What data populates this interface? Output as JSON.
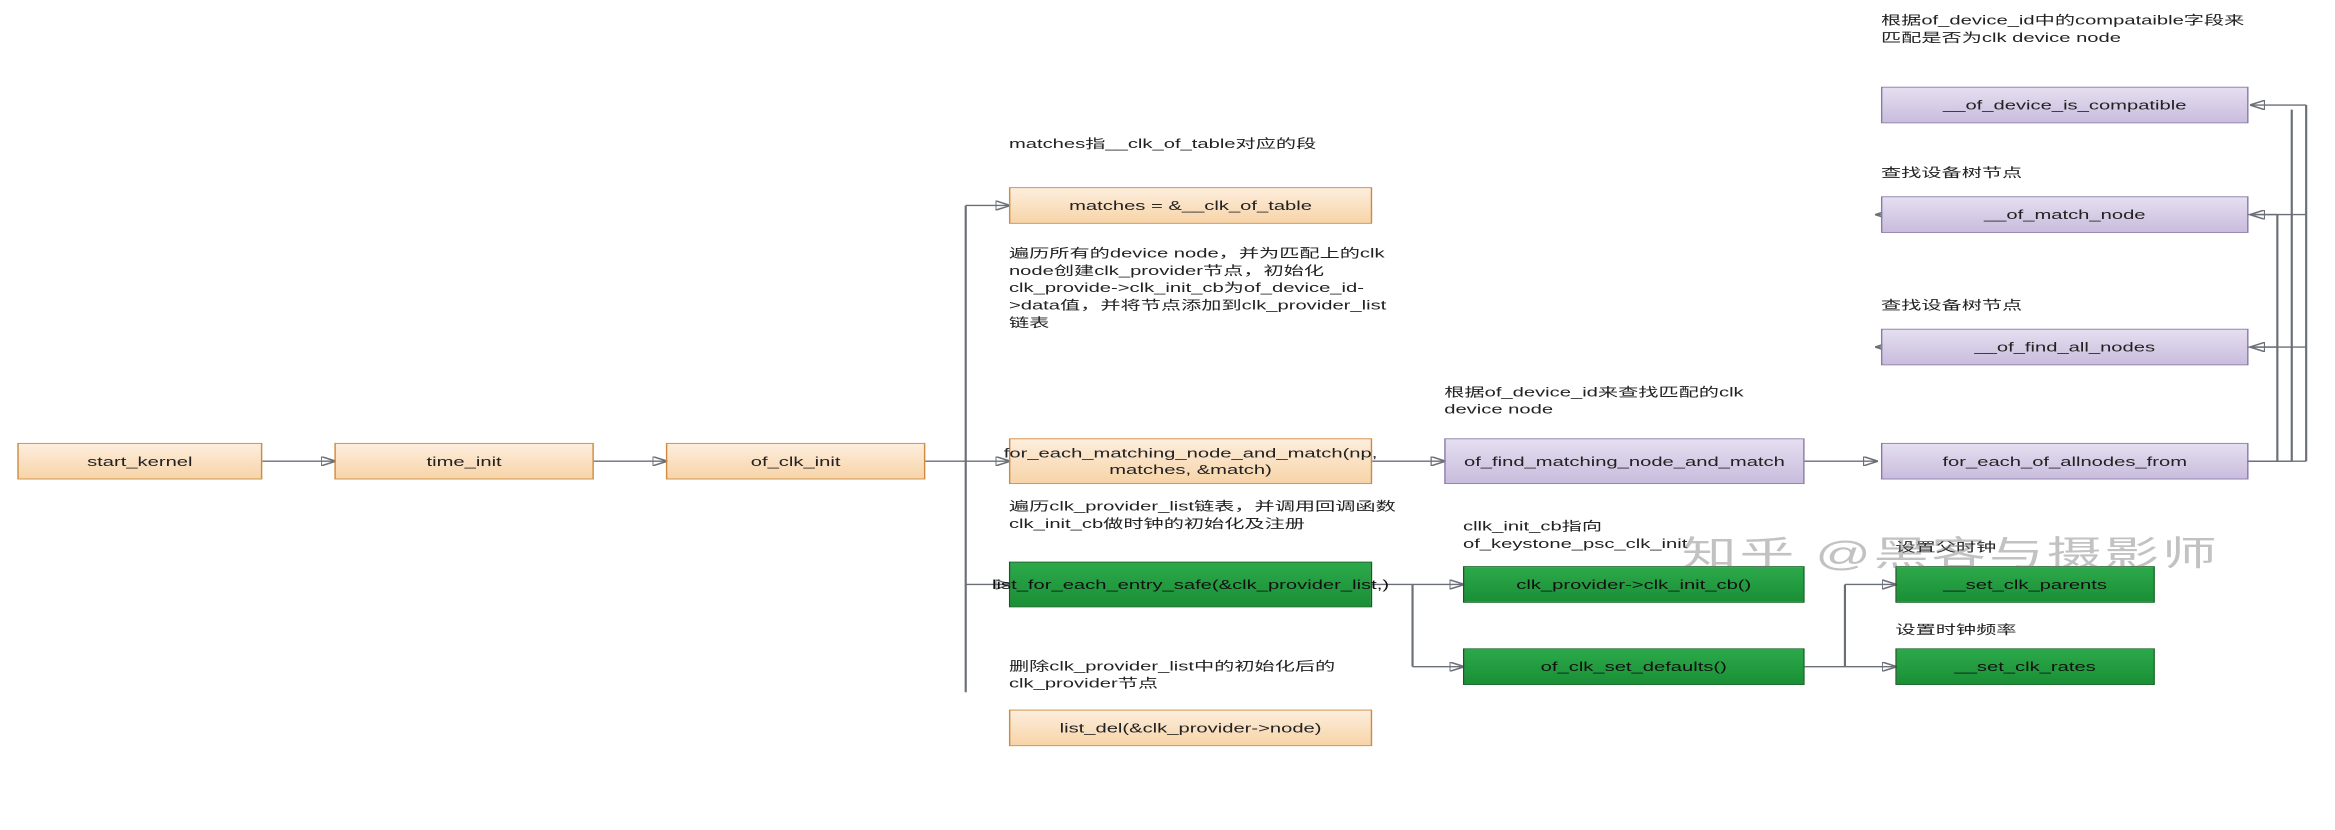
{
  "watermark": "知乎 @黑客与摄影师",
  "nodes": {
    "start_kernel": "start_kernel",
    "time_init": "time_init",
    "of_clk_init": "of_clk_init",
    "matches": "matches = &__clk_of_table",
    "for_each_matching": "for_each_matching_node_and_match(np, matches, &match)",
    "list_for_each": "list_for_each_entry_safe(&clk_provider_list,)",
    "list_del": "list_del(&clk_provider->node)",
    "of_find_matching": "of_find_matching_node_and_match",
    "for_each_allnodes": "for_each_of_allnodes_from",
    "of_find_all_nodes": "__of_find_all_nodes",
    "of_match_node": "__of_match_node",
    "of_device_is_compatible": "__of_device_is_compatible",
    "clk_init_cb": "clk_provider->clk_init_cb()",
    "of_clk_set_defaults": "of_clk_set_defaults()",
    "set_clk_parents": "__set_clk_parents",
    "set_clk_rates": "__set_clk_rates"
  },
  "annotations": {
    "matches_note": "matches指__clk_of_table对应的段",
    "foreach_note": "遍历所有的device node，并为匹配上的clk node创建clk_provider节点，初始化clk_provide->clk_init_cb为of_device_id->data值，并将节点添加到clk_provider_list链表",
    "listfor_note": "遍历clk_provider_list链表，并调用回调函数clk_init_cb做时钟的初始化及注册",
    "listdel_note": "删除clk_provider_list中的初始化后的clk_provider节点",
    "of_find_match_note": "根据of_device_id来查找匹配的clk device node",
    "clk_init_cb_note": "cllk_init_cb指向of_keystone_psc_clk_init",
    "find_all_nodes_note": "查找设备树节点",
    "match_node_note": "查找设备树节点",
    "compat_note": "根据of_device_id中的compataible字段来匹配是否为clk device node",
    "set_parents_note": "设置父时钟",
    "set_rates_note": "设置时钟频率"
  }
}
